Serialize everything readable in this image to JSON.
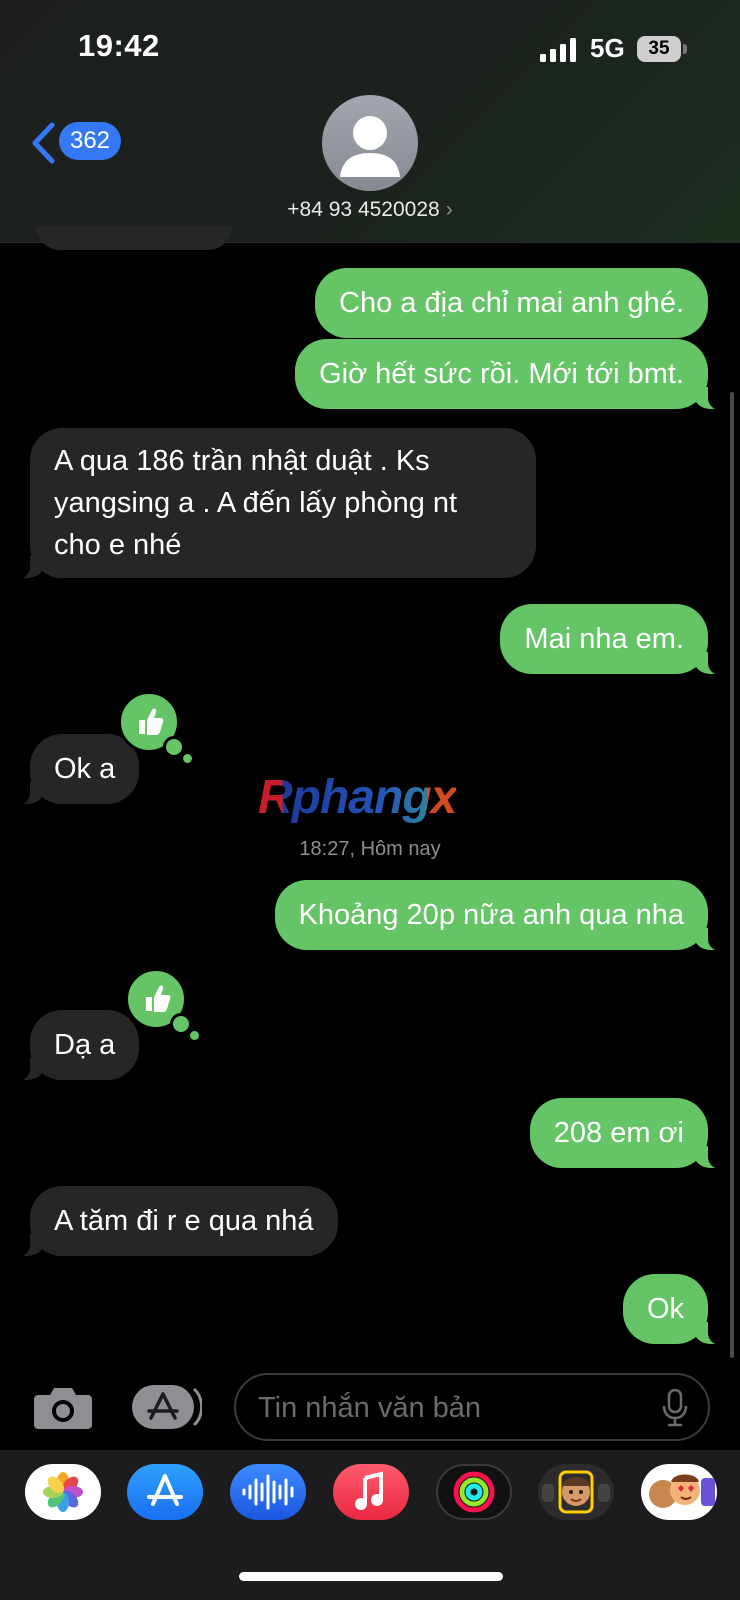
{
  "status_bar": {
    "time": "19:42",
    "network": "5G",
    "battery": "35"
  },
  "header": {
    "back_count": "362",
    "contact": "+84 93 4520028",
    "contact_chevron": "›"
  },
  "messages": [
    {
      "text": "Cho a địa chỉ mai anh ghé.",
      "direction": "out"
    },
    {
      "text": "Giờ hết sức rồi. Mới tới bmt.",
      "direction": "out"
    },
    {
      "text_lines": [
        "A qua 186 trần nhật duật . Ks",
        "yangsing a . A đến lấy phòng nt",
        "cho e nhé"
      ],
      "direction": "in"
    },
    {
      "text": "Mai nha em.",
      "direction": "out"
    },
    {
      "text": "Ok a",
      "direction": "in",
      "tapback": "thumbs-up"
    },
    {
      "text": "Khoảng 20p nữa anh qua nha",
      "direction": "out"
    },
    {
      "text": "Dạ a",
      "direction": "in",
      "tapback": "thumbs-up"
    },
    {
      "text": "208 em ơi",
      "direction": "out"
    },
    {
      "text": "A tăm đi r e qua nhá",
      "direction": "in"
    },
    {
      "text": "Ok",
      "direction": "out"
    }
  ],
  "timestamp": {
    "time": "18:27,",
    "day": "Hôm nay"
  },
  "watermark": "Rphangx",
  "input": {
    "placeholder": "Tin nhắn văn bản"
  },
  "app_strip": [
    "photos-app",
    "app-store-app",
    "audio-messages-app",
    "music-app",
    "fitness-app",
    "memoji-app",
    "animoji-stickers-app"
  ],
  "colors": {
    "outgoing": "#65c466",
    "incoming": "#262628",
    "accent": "#3478f6"
  }
}
